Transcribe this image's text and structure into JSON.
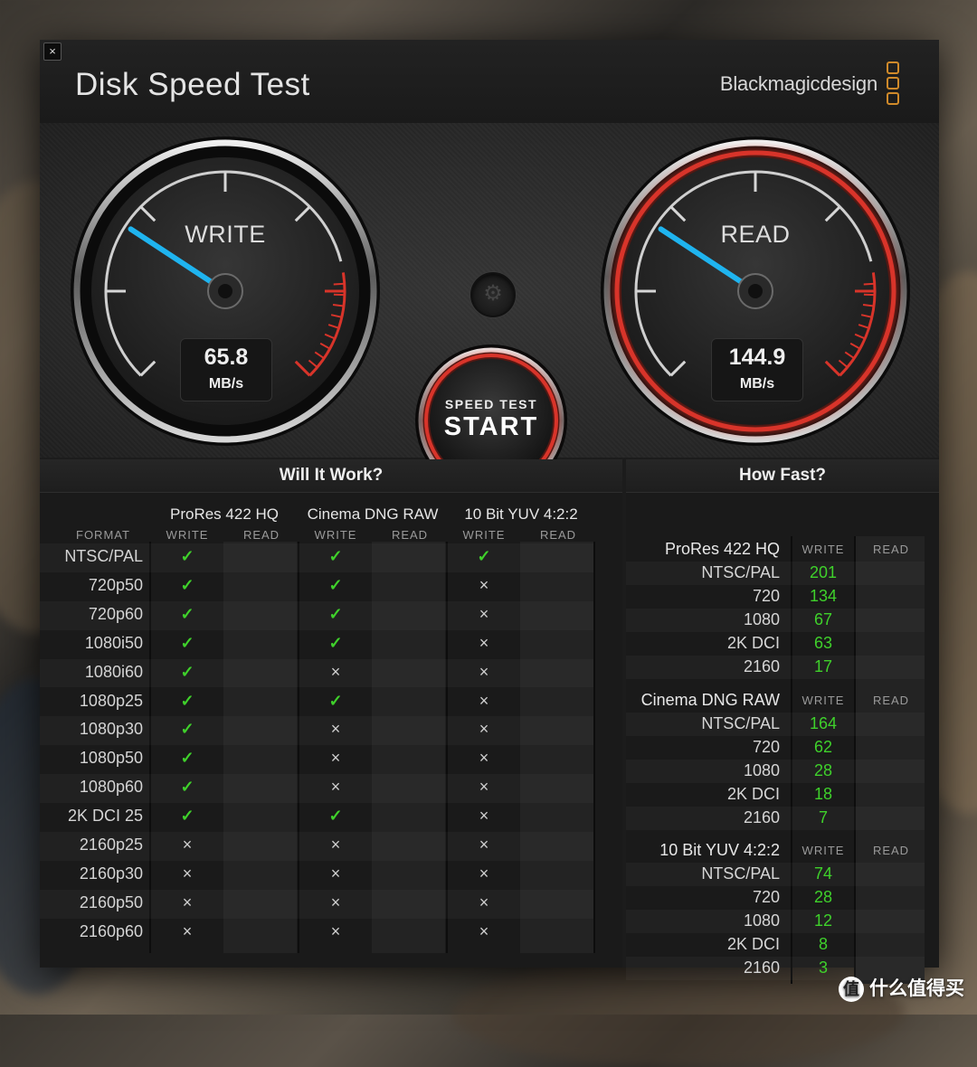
{
  "window": {
    "title": "Disk Speed Test",
    "brand": "Blackmagicdesign",
    "close_label": "×"
  },
  "write_gauge": {
    "label": "WRITE",
    "value": "65.8",
    "unit": "MB/s",
    "level": 0.29
  },
  "read_gauge": {
    "label": "READ",
    "value": "144.9",
    "unit": "MB/s",
    "level": 0.29
  },
  "start_button": {
    "line1": "SPEED TEST",
    "line2": "START"
  },
  "settings": {
    "icon": "gear-icon",
    "glyph": "⚙"
  },
  "colors": {
    "write_needle": "#1fb4ef",
    "read_needle": "#1fb4ef",
    "ok": "#3fd12b",
    "accent_red": "#d8342a",
    "brand_orange": "#d08a2a"
  },
  "will_it_work": {
    "title": "Will It Work?",
    "format_header": "FORMAT",
    "write_header": "WRITE",
    "read_header": "READ",
    "codecs": [
      "ProRes 422 HQ",
      "Cinema DNG RAW",
      "10 Bit YUV 4:2:2"
    ],
    "rows": [
      {
        "format": "NTSC/PAL",
        "checks": [
          true,
          true,
          true
        ]
      },
      {
        "format": "720p50",
        "checks": [
          true,
          true,
          false
        ]
      },
      {
        "format": "720p60",
        "checks": [
          true,
          true,
          false
        ]
      },
      {
        "format": "1080i50",
        "checks": [
          true,
          true,
          false
        ]
      },
      {
        "format": "1080i60",
        "checks": [
          true,
          false,
          false
        ]
      },
      {
        "format": "1080p25",
        "checks": [
          true,
          true,
          false
        ]
      },
      {
        "format": "1080p30",
        "checks": [
          true,
          false,
          false
        ]
      },
      {
        "format": "1080p50",
        "checks": [
          true,
          false,
          false
        ]
      },
      {
        "format": "1080p60",
        "checks": [
          true,
          false,
          false
        ]
      },
      {
        "format": "2K DCI 25",
        "checks": [
          true,
          true,
          false
        ]
      },
      {
        "format": "2160p25",
        "checks": [
          false,
          false,
          false
        ]
      },
      {
        "format": "2160p30",
        "checks": [
          false,
          false,
          false
        ]
      },
      {
        "format": "2160p50",
        "checks": [
          false,
          false,
          false
        ]
      },
      {
        "format": "2160p60",
        "checks": [
          false,
          false,
          false
        ]
      }
    ],
    "ok_glyph": "✓",
    "no_glyph": "×"
  },
  "how_fast": {
    "title": "How Fast?",
    "write_header": "WRITE",
    "read_header": "READ",
    "groups": [
      {
        "name": "ProRes 422 HQ",
        "rows": [
          {
            "format": "NTSC/PAL",
            "write": "201"
          },
          {
            "format": "720",
            "write": "134"
          },
          {
            "format": "1080",
            "write": "67"
          },
          {
            "format": "2K DCI",
            "write": "63"
          },
          {
            "format": "2160",
            "write": "17"
          }
        ]
      },
      {
        "name": "Cinema DNG RAW",
        "rows": [
          {
            "format": "NTSC/PAL",
            "write": "164"
          },
          {
            "format": "720",
            "write": "62"
          },
          {
            "format": "1080",
            "write": "28"
          },
          {
            "format": "2K DCI",
            "write": "18"
          },
          {
            "format": "2160",
            "write": "7"
          }
        ]
      },
      {
        "name": "10 Bit YUV 4:2:2",
        "rows": [
          {
            "format": "NTSC/PAL",
            "write": "74"
          },
          {
            "format": "720",
            "write": "28"
          },
          {
            "format": "1080",
            "write": "12"
          },
          {
            "format": "2K DCI",
            "write": "8"
          },
          {
            "format": "2160",
            "write": "3"
          }
        ]
      }
    ]
  },
  "watermark": {
    "text": "什么值得买",
    "icon_glyph": "值"
  }
}
